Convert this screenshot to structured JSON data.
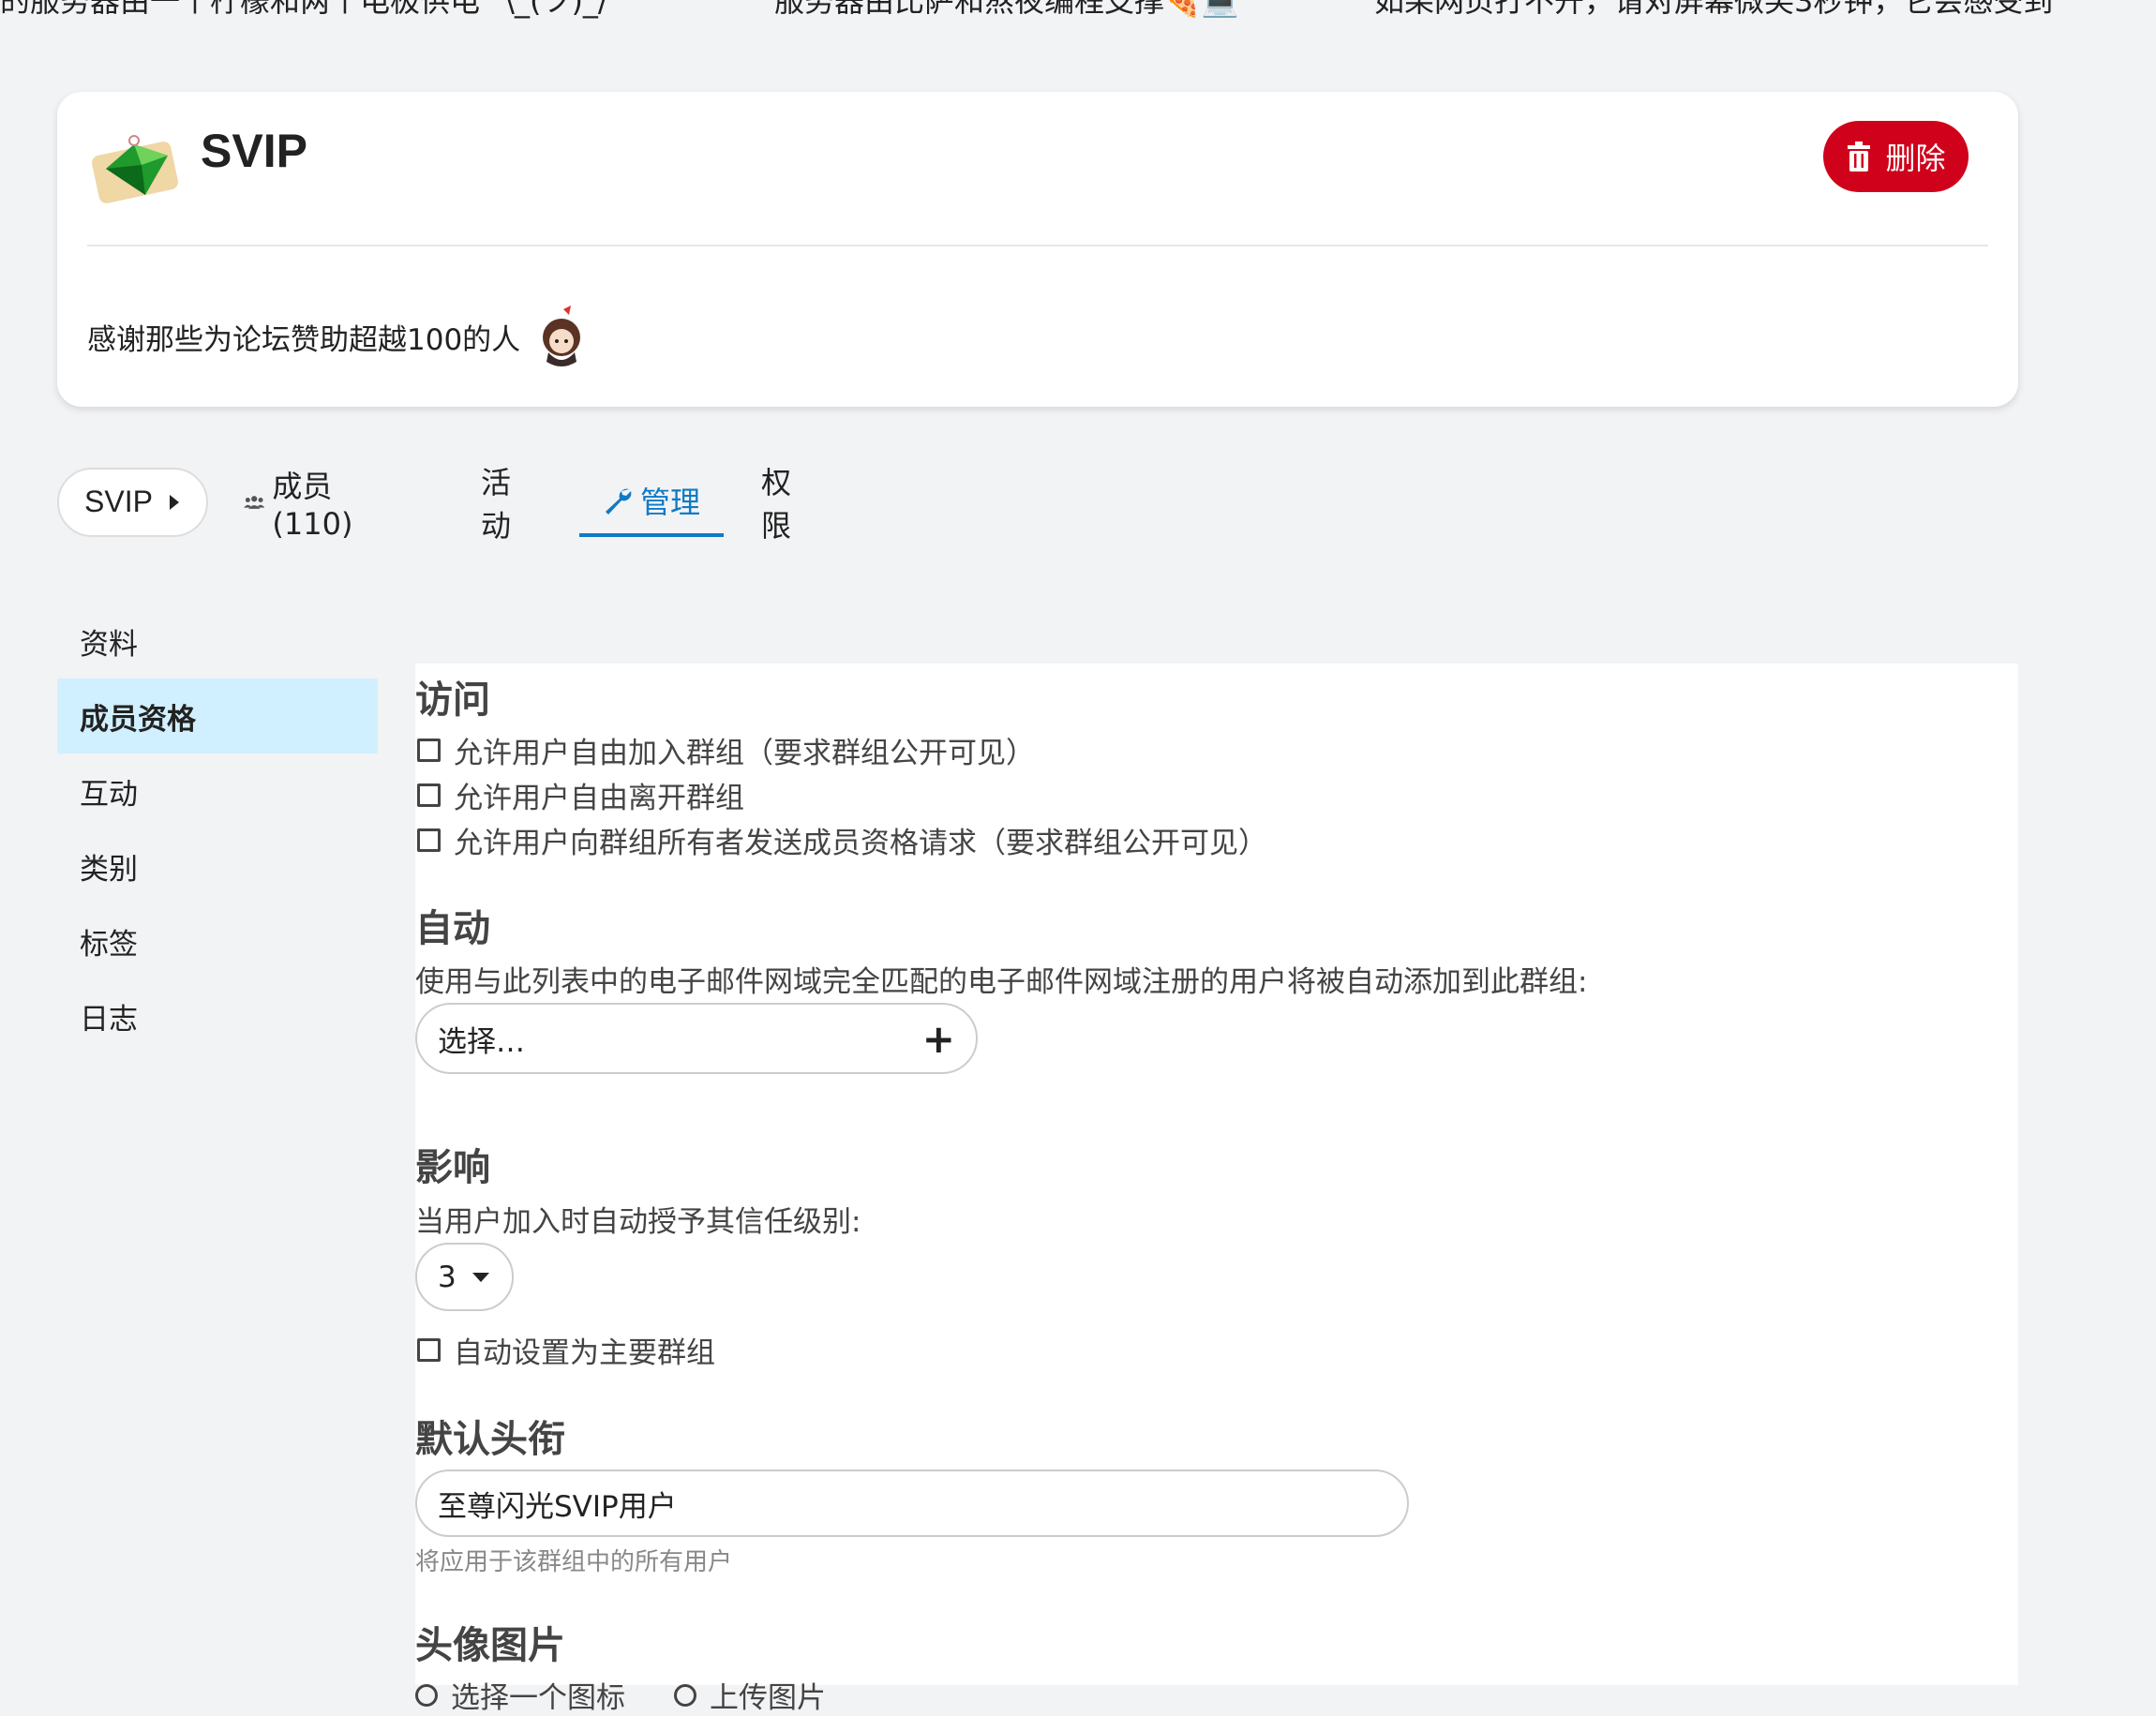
{
  "ticker": {
    "item1": "的服务器由一个柠檬和两个电极供电 ¯\\_(ツ)_/¯",
    "item2": "服务器由比萨和熬夜编程支撑🍕💻",
    "item3": "如果网页打不开，请对屏幕微笑3秒钟，它会感受到"
  },
  "group": {
    "name": "SVIP",
    "delete_label": "删除",
    "description": "感谢那些为论坛赞助超越100的人"
  },
  "tabs": {
    "crumb": "SVIP",
    "members": "成员 (110)",
    "activity": "活动",
    "manage": "管理",
    "permissions": "权限"
  },
  "nav": {
    "items": [
      "资料",
      "成员资格",
      "互动",
      "类别",
      "标签",
      "日志"
    ],
    "active_index": 1
  },
  "panel": {
    "access": {
      "heading": "访问",
      "options": [
        "允许用户自由加入群组（要求群组公开可见）",
        "允许用户自由离开群组",
        "允许用户向群组所有者发送成员资格请求（要求群组公开可见）"
      ]
    },
    "auto": {
      "heading": "自动",
      "description": "使用与此列表中的电子邮件网域完全匹配的电子邮件网域注册的用户将被自动添加到此群组:",
      "select_placeholder": "选择…"
    },
    "effect": {
      "heading": "影响",
      "trust_label": "当用户加入时自动授予其信任级别:",
      "trust_value": "3",
      "primary_label": "自动设置为主要群组"
    },
    "title": {
      "heading": "默认头衔",
      "value": "至尊闪光SVIP用户",
      "hint": "将应用于该群组中的所有用户"
    },
    "avatar": {
      "heading": "头像图片",
      "option1": "选择一个图标",
      "option2": "上传图片"
    }
  },
  "colors": {
    "accent": "#0f7ac6",
    "danger": "#d0021b",
    "nav_active": "#d1f0ff"
  }
}
